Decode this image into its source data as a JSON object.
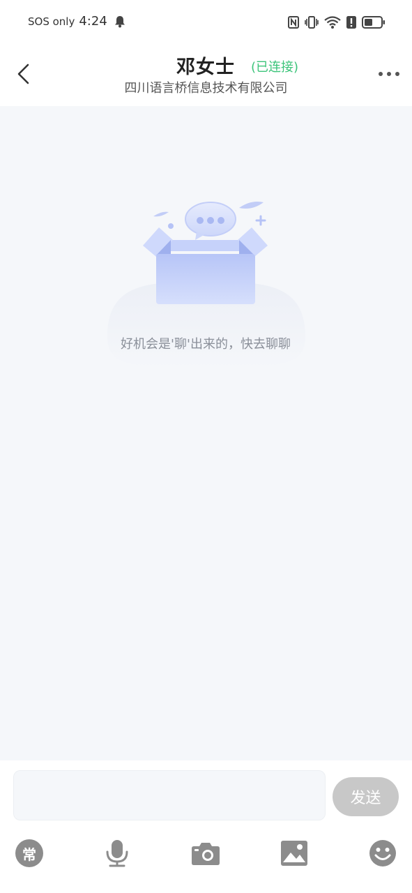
{
  "status_bar": {
    "carrier": "SOS only",
    "time": "4:24",
    "icons": [
      "bell-icon",
      "nfc-icon",
      "vibrate-icon",
      "wifi-icon",
      "alert-icon",
      "battery-icon"
    ]
  },
  "header": {
    "name": "邓女士",
    "connection_status": "(已连接)",
    "company": "四川语言桥信息技术有限公司",
    "back_icon": "chevron-left-icon",
    "more_icon": "more-icon"
  },
  "chat": {
    "empty_message": "好机会是'聊'出来的，快去聊聊"
  },
  "composer": {
    "input_value": "",
    "send_label": "发送"
  },
  "toolbar": {
    "common_label": "常",
    "items": [
      "common-phrases",
      "microphone-icon",
      "camera-icon",
      "image-icon",
      "emoji-icon"
    ]
  },
  "colors": {
    "connected": "#3cc47a",
    "chat_background": "#f5f7fa",
    "send_disabled": "#c8c8c8",
    "toolbar_icon": "#8c8c8c"
  }
}
